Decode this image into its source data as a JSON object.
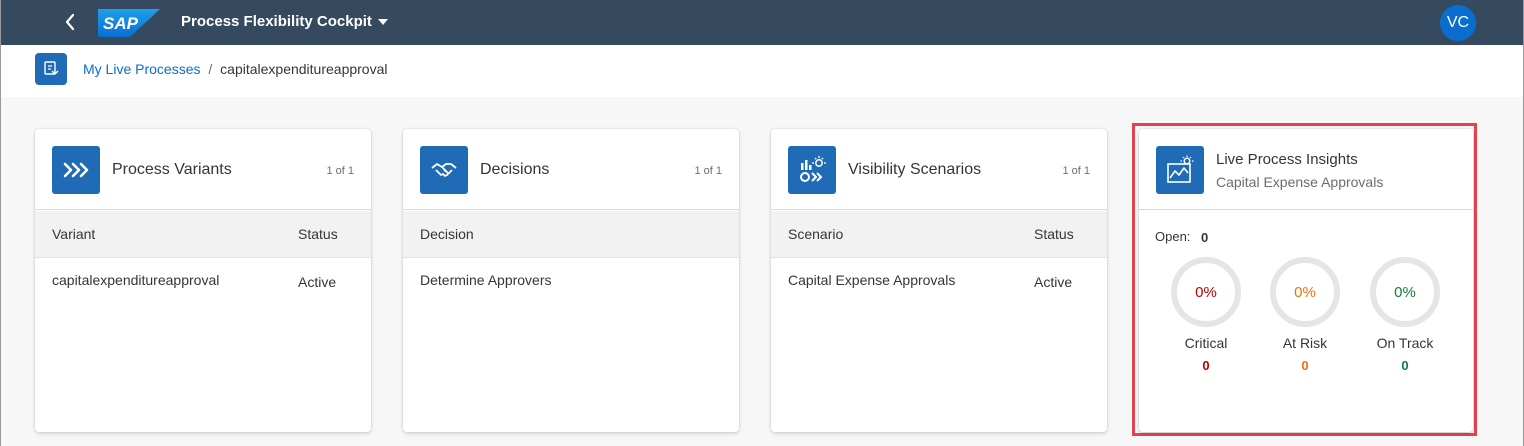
{
  "shell": {
    "app_title": "Process Flexibility Cockpit",
    "logo_text": "SAP",
    "avatar_initials": "VC"
  },
  "breadcrumb": {
    "link": "My Live Processes",
    "separator": "/",
    "current": "capitalexpenditureapproval"
  },
  "cards": {
    "variants": {
      "title": "Process Variants",
      "count": "1 of 1",
      "columns": [
        "Variant",
        "Status"
      ],
      "rows": [
        [
          "capitalexpenditureapproval",
          "Active"
        ]
      ]
    },
    "decisions": {
      "title": "Decisions",
      "count": "1 of 1",
      "columns": [
        "Decision"
      ],
      "rows": [
        [
          "Determine Approvers"
        ]
      ]
    },
    "visibility": {
      "title": "Visibility Scenarios",
      "count": "1 of 1",
      "columns": [
        "Scenario",
        "Status"
      ],
      "rows": [
        [
          "Capital Expense Approvals",
          "Active"
        ]
      ]
    },
    "insights": {
      "title": "Live Process Insights",
      "subtitle": "Capital Expense Approvals",
      "open_label": "Open:",
      "open_value": "0",
      "metrics": [
        {
          "label": "Critical",
          "percent": "0%",
          "count": "0",
          "color": "#bb0000"
        },
        {
          "label": "At Risk",
          "percent": "0%",
          "count": "0",
          "color": "#e9730c"
        },
        {
          "label": "On Track",
          "percent": "0%",
          "count": "0",
          "color": "#107e3e"
        }
      ]
    }
  },
  "colors": {
    "shell_bg": "#354a5f",
    "accent": "#0a6ed1",
    "icon_tile": "#1f6bb5",
    "highlight": "#e0454f"
  },
  "icons": [
    "back-arrow-icon",
    "sap-logo",
    "dropdown-caret-icon",
    "process-icon",
    "chevrons-icon",
    "handshake-icon",
    "visibility-icon",
    "insights-chart-icon"
  ]
}
